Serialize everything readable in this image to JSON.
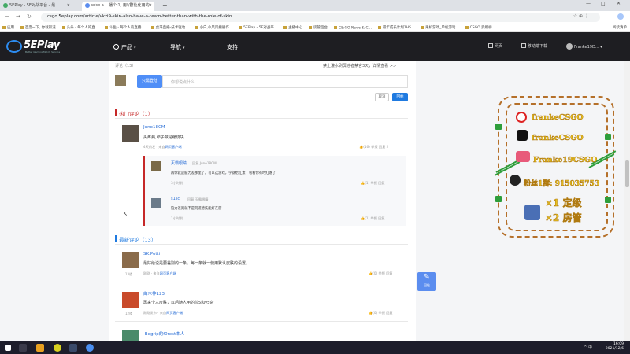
{
  "browser": {
    "tabs": [
      {
        "label": "5EPlay - 5E对战平台 - 最...",
        "active": false
      },
      {
        "label": "wise a...  播个l1, 用!/群处化用的 ...",
        "active": true
      }
    ],
    "new_tab": "+",
    "window_controls": [
      "—",
      "□",
      "✕"
    ],
    "nav": {
      "back": "←",
      "forward": "→",
      "reload": "↻"
    },
    "url": "csgo.5eplay.com/article/vkzi9-skin-also-have-a-team-better-than-with-the-role-of-skin",
    "omnibox_icons": "☆   ⊕   ⋮",
    "bookmarks": [
      "应用",
      "百度一下, 你就知道",
      "头条 - 每个人的直...",
      "斗鱼 - 每个人的直播...",
      "虎牙直播-技术驱动...",
      "小白,小风风撒剧作...",
      "5EPlay - 5E对战平...",
      "主播中心",
      "房管后台",
      "CS:GO News & C...",
      "最年成长计划1HS...",
      "果机游戏_单机游戏...",
      "CSGO 受赠榜"
    ],
    "bookmark_right": "阅读清单"
  },
  "site": {
    "logo": "5EPlay",
    "logo_sub": "Better Gaming Match Service",
    "nav": [
      {
        "label": "产品",
        "has_caret": true
      },
      {
        "label": "导航",
        "has_caret": true
      },
      {
        "label": "支持",
        "has_caret": false
      }
    ],
    "header_right": {
      "download": "网页",
      "mobile": "移动端下载",
      "user": "Franke19D..."
    }
  },
  "comments": {
    "header_label": "评论（13）",
    "notice": "禁止灌水刷屏违者禁言3天，详情查看 >>",
    "login_button": "只需登陆",
    "input_placeholder": "你想说点什么",
    "cancel_button": "取消",
    "post_button": "回帖",
    "hot_title": "热门评论（1）",
    "latest_title": "最新评论（13）",
    "hot": [
      {
        "user": "Juno18CM",
        "text": "头疼病,卵子做是编烧块",
        "meta": "4天前发 · 来自",
        "meta_link": "网页客户端",
        "thumbs": "(16)",
        "report": "举报",
        "reply": "回复",
        "count": "2",
        "replies": [
          {
            "user": "灭霸眼睛",
            "tag": "回复",
            "to": "Juno18CM",
            "text": "再你就是脑力差那里了。可以这游戏，学就给红素，看看你有时红谁了",
            "time": "3小时前",
            "thumbs": "(1)",
            "report": "举报",
            "reply": "回复"
          },
          {
            "user": "s1sc",
            "tag": "回复",
            "to": "灭霸眼睛",
            "text": "脑力差则就不是何道德技能好在游",
            "time": "1小时前",
            "thumbs": "(1)",
            "report": "举报",
            "reply": "回复"
          }
        ]
      }
    ],
    "latest": [
      {
        "user": "SK.Potti",
        "text": "最好给说是要差别的一条，每一条就一使用默认皮肤的设置。",
        "meta": "刚刚 · 来自",
        "meta_link": "网页客户端",
        "level": "13楼",
        "thumbs": "(0)",
        "report": "举报",
        "reply": "回复"
      },
      {
        "user": "曲木神123",
        "text": "再来个人皮肤，以后随人用的位5和v5杂",
        "meta": "刚刚发布 · 来自",
        "meta_link": "网页客户端",
        "level": "12楼",
        "thumbs": "(0)",
        "report": "举报",
        "reply": "回复"
      },
      {
        "user": "-Begrip的f0rest本人-",
        "text": "",
        "meta": "",
        "meta_link": "",
        "level": "",
        "thumbs": "",
        "report": "",
        "reply": ""
      }
    ]
  },
  "fab": {
    "label": "回帖"
  },
  "promo": {
    "lines": [
      "frankeCSGO",
      "frankeCSGO",
      "Franke19CSGO",
      "粉丝1群: 915035753",
      "×1 定级",
      "×2 房管"
    ],
    "colors": {
      "border": "#b5702a",
      "text": "#e8c21f",
      "accent": "#2e9e3b"
    }
  },
  "taskbar": {
    "time": "16:09",
    "date": "2021/12/6",
    "sys": "^ 中"
  },
  "colors": {
    "brand": "#1f7ae0",
    "header": "#1e1e22",
    "hot": "#c62828"
  }
}
